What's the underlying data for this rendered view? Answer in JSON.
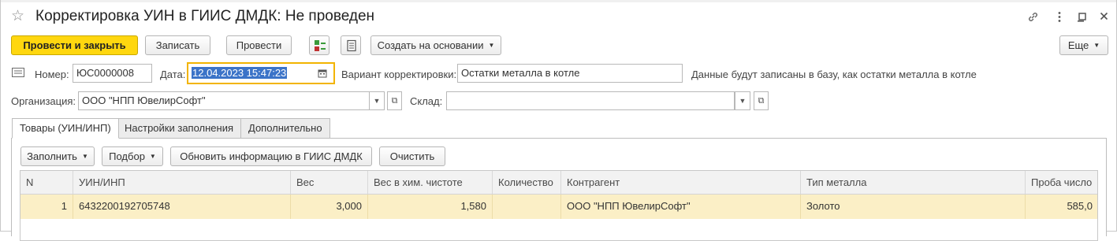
{
  "window": {
    "title": "Корректировка УИН в ГИИС ДМДК: Не проведен"
  },
  "toolbar": {
    "post_close_label": "Провести и закрыть",
    "save_label": "Записать",
    "post_label": "Провести",
    "create_based_label": "Создать на основании",
    "more_label": "Еще"
  },
  "form": {
    "number_label": "Номер:",
    "number_value": "ЮС0000008",
    "date_label": "Дата:",
    "date_value": "12.04.2023 15:47:23",
    "variant_label": "Вариант корректировки:",
    "variant_value": "Остатки металла в котле",
    "variant_note": "Данные будут записаны в базу, как остатки металла в котле",
    "org_label": "Организация:",
    "org_value": "ООО \"НПП ЮвелирСофт\"",
    "warehouse_label": "Склад:",
    "warehouse_value": ""
  },
  "tabs": [
    {
      "label": "Товары (УИН/ИНП)",
      "active": true
    },
    {
      "label": "Настройки заполнения",
      "active": false
    },
    {
      "label": "Дополнительно",
      "active": false
    }
  ],
  "table_toolbar": {
    "fill_label": "Заполнить",
    "select_label": "Подбор",
    "update_label": "Обновить информацию в ГИИС ДМДК",
    "clear_label": "Очистить"
  },
  "table": {
    "columns": [
      "N",
      "УИН/ИНП",
      "Вес",
      "Вес в хим. чистоте",
      "Количество",
      "Контрагент",
      "Тип металла",
      "Проба число"
    ],
    "rows": [
      [
        "1",
        "6432200192705748",
        "3,000",
        "1,580",
        "",
        "ООО \"НПП ЮвелирСофт\"",
        "Золото",
        "585,0"
      ]
    ]
  },
  "colors": {
    "primary_button": "#ffd70f",
    "selected_row": "#fbefc6",
    "focus_border": "#f2b400",
    "text_selection": "#3b73c8"
  },
  "icons": [
    "star-icon",
    "link-icon",
    "more-vert-icon",
    "minimize-icon",
    "maximize-icon",
    "close-icon",
    "structure-icon",
    "print-icon",
    "document-icon",
    "calendar-icon",
    "open-icon"
  ]
}
